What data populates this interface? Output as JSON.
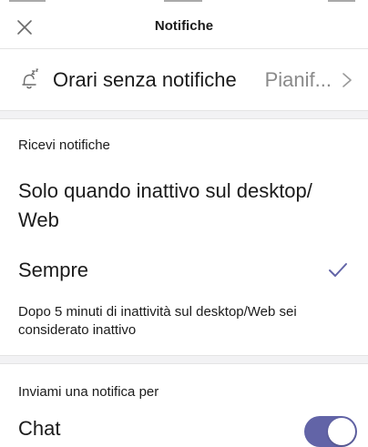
{
  "header": {
    "title": "Notifiche",
    "close_icon": "close-icon"
  },
  "quiet_hours": {
    "label": "Orari senza notifiche",
    "value": "Pianif...",
    "icon": "bell-snooze-icon"
  },
  "receive": {
    "section_label": "Ricevi notifiche",
    "options": [
      {
        "label": "Solo quando inattivo sul desktop/ Web",
        "selected": false
      },
      {
        "label": "Sempre",
        "selected": true
      }
    ],
    "note": "Dopo 5 minuti di inattività sul desktop/Web sei considerato inattivo"
  },
  "notify_for": {
    "section_label": "Inviami una notifica per",
    "items": [
      {
        "label": "Chat",
        "enabled": true
      }
    ]
  },
  "colors": {
    "accent": "#6264a7",
    "text": "#1b1b1b",
    "muted": "#8a8a8a",
    "separator": "#e4e4e4"
  }
}
